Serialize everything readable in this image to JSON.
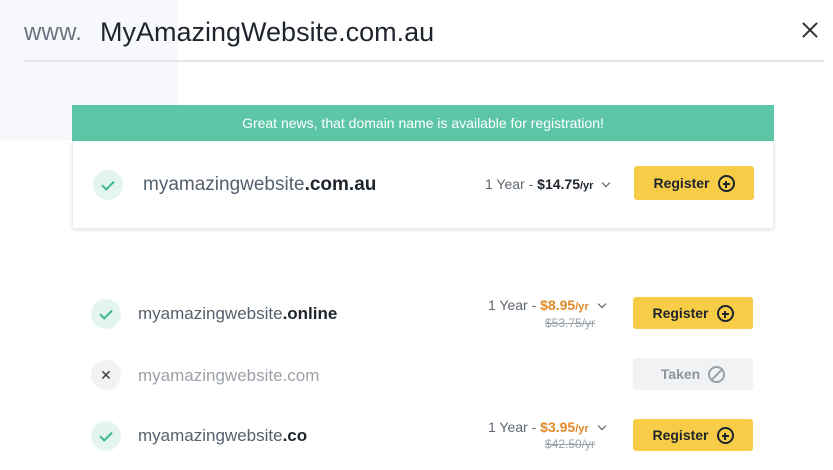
{
  "search": {
    "prefix": "www.",
    "value": "MyAmazingWebsite.com.au"
  },
  "banner": {
    "message": "Great news, that domain name is available for registration!"
  },
  "featured": {
    "name": "myamazingwebsite",
    "tld": ".com.au",
    "term": "1 Year -",
    "price": "$14.75",
    "per": "/yr",
    "button": "Register",
    "status": "available"
  },
  "results": [
    {
      "name": "myamazingwebsite",
      "tld": ".online",
      "term": "1 Year -",
      "price": "$8.95",
      "per": "/yr",
      "old_price": "$53.75/yr",
      "button": "Register",
      "status": "available"
    },
    {
      "name": "myamazingwebsite.com",
      "tld": "",
      "button": "Taken",
      "status": "taken"
    },
    {
      "name": "myamazingwebsite",
      "tld": ".co",
      "term": "1 Year -",
      "price": "$3.95",
      "per": "/yr",
      "old_price": "$42.50/yr",
      "button": "Register",
      "status": "available"
    }
  ],
  "icons": {
    "close": "close-icon",
    "check": "check-icon",
    "cross": "cross-icon",
    "plus": "plus-circle-icon",
    "ban": "ban-icon",
    "chevron": "chevron-down-icon"
  },
  "colors": {
    "banner": "#5cc6a7",
    "register_button": "#f7cc46",
    "sale_price": "#e08a28",
    "available": "#3db98f"
  }
}
